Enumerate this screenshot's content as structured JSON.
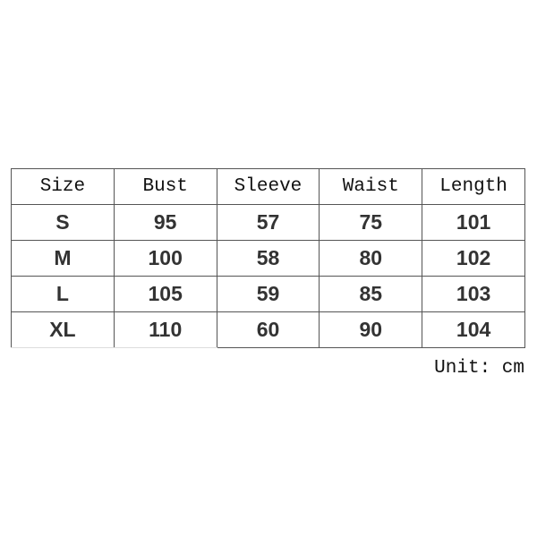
{
  "table": {
    "headers": [
      "Size",
      "Bust",
      "Sleeve",
      "Waist",
      "Length"
    ],
    "rows": [
      [
        "S",
        "95",
        "57",
        "75",
        "101"
      ],
      [
        "M",
        "100",
        "58",
        "80",
        "102"
      ],
      [
        "L",
        "105",
        "59",
        "85",
        "103"
      ],
      [
        "XL",
        "110",
        "60",
        "90",
        "104"
      ]
    ]
  },
  "unit_label": "Unit: cm"
}
